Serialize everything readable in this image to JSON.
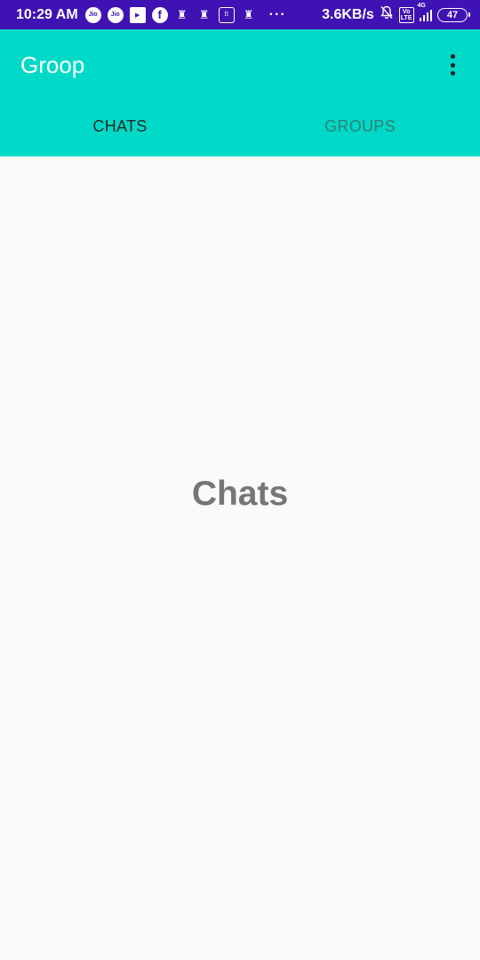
{
  "status_bar": {
    "time": "10:29 AM",
    "icons": [
      {
        "name": "jio-icon",
        "text": "Jio"
      },
      {
        "name": "jio-icon",
        "text": "Jio"
      },
      {
        "name": "video-player-icon",
        "text": "▶"
      },
      {
        "name": "facebook-icon",
        "text": "f"
      },
      {
        "name": "news-app-icon",
        "text": "♜"
      },
      {
        "name": "news-app-icon",
        "text": "♜"
      },
      {
        "name": "calculator-icon",
        "text": "⁞⁞"
      },
      {
        "name": "news-app-icon",
        "text": "♜"
      }
    ],
    "more": "···",
    "net_speed": "3.6KB/s",
    "volte_line1": "Vo",
    "volte_line2": "LTE",
    "network": "4G",
    "battery": "47",
    "background_color": "#3f12b3"
  },
  "app_bar": {
    "title": "Groop",
    "background_color": "#00d9c7",
    "menu_icon": "overflow-menu-icon"
  },
  "tabs": [
    {
      "label": "CHATS",
      "selected": true
    },
    {
      "label": "GROUPS",
      "selected": false
    }
  ],
  "content": {
    "label": "Chats"
  }
}
